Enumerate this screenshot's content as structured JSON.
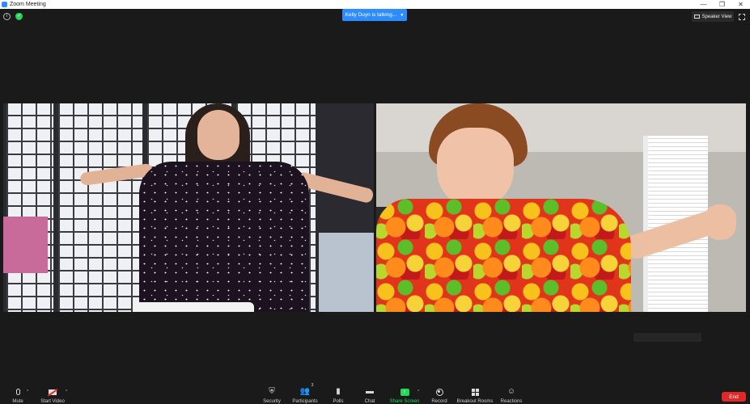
{
  "window": {
    "title": "Zoom Meeting",
    "minimize": "—",
    "restore": "❐",
    "close": "✕"
  },
  "topbar": {
    "talking_label": "Kelly Duyn is talking...",
    "speaker_view_label": "Speaker View"
  },
  "toolbar": {
    "mute_label": "Mute",
    "start_video_label": "Start Video",
    "security_label": "Security",
    "participants_label": "Participants",
    "participants_count": "3",
    "polls_label": "Polls",
    "chat_label": "Chat",
    "share_screen_label": "Share Screen",
    "record_label": "Record",
    "breakout_rooms_label": "Breakout Rooms",
    "reactions_label": "Reactions",
    "end_label": "End"
  },
  "colors": {
    "accent": "#2d8cff",
    "share_green": "#23d959",
    "end_red": "#e02828",
    "background": "#1a1a1a"
  }
}
